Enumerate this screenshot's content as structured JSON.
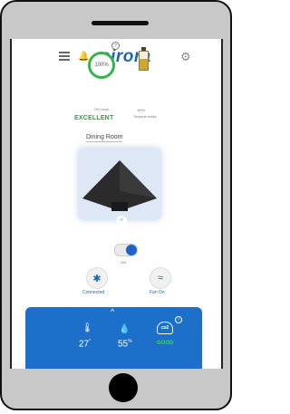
{
  "app": {
    "logo": "airora"
  },
  "oh": {
    "ring_text": "100%",
    "info": "?",
    "label": "OH Level",
    "status": "EXCELLENT"
  },
  "bottle": {
    "percent": "60%",
    "label": "Terpene bottle",
    "fill_level": 0.6,
    "fill_color": "#d1a532"
  },
  "room": {
    "name": "Dining Room"
  },
  "device": {
    "add_icon": "+"
  },
  "power": {
    "label": "ON",
    "on": true
  },
  "controls": {
    "connected_label": "Connected",
    "fan_label": "Fan On"
  },
  "stats": {
    "temp": "27",
    "temp_unit": "°",
    "humidity": "55",
    "humidity_unit": "%",
    "co2_icon_text": "co2",
    "co2_info": "?",
    "co2_status": "GOOD",
    "expand_icon": "^"
  },
  "colors": {
    "brand": "#1f64b4",
    "good": "#2ea23e",
    "panel": "#1d70c9"
  }
}
